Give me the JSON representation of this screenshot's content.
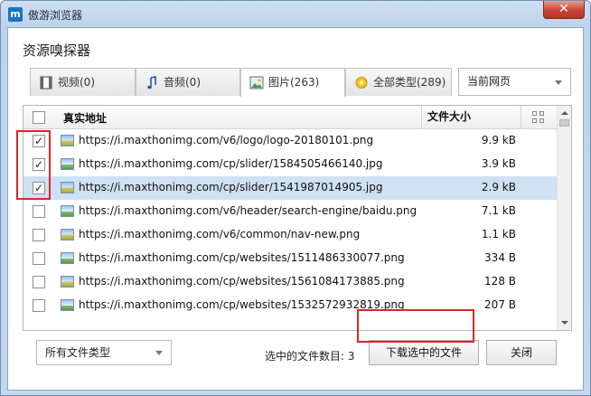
{
  "window": {
    "title": "傲游浏览器",
    "close_glyph": "✕"
  },
  "dialog": {
    "title": "资源嗅探器"
  },
  "tabs": [
    {
      "label": "视频(0)",
      "icon": "film-icon"
    },
    {
      "label": "音频(0)",
      "icon": "music-note-icon"
    },
    {
      "label": "图片(263)",
      "icon": "image-icon",
      "active": true
    },
    {
      "label": "全部类型(289)",
      "icon": "star-icon"
    }
  ],
  "scope_select": {
    "value": "当前网页"
  },
  "list": {
    "header": {
      "url": "真实地址",
      "size": "文件大小"
    },
    "rows": [
      {
        "url": "https://i.maxthonimg.com/v6/logo/logo-20180101.png",
        "size": "9.9 kB",
        "checked": true,
        "selected": false
      },
      {
        "url": "https://i.maxthonimg.com/cp/slider/1584505466140.jpg",
        "size": "3.9 kB",
        "checked": true,
        "selected": false
      },
      {
        "url": "https://i.maxthonimg.com/cp/slider/1541987014905.jpg",
        "size": "2.9 kB",
        "checked": true,
        "selected": true
      },
      {
        "url": "https://i.maxthonimg.com/v6/header/search-engine/baidu.png",
        "size": "7.1 kB",
        "checked": false,
        "selected": false
      },
      {
        "url": "https://i.maxthonimg.com/v6/common/nav-new.png",
        "size": "1.1 kB",
        "checked": false,
        "selected": false
      },
      {
        "url": "https://i.maxthonimg.com/cp/websites/1511486330077.png",
        "size": "334 B",
        "checked": false,
        "selected": false
      },
      {
        "url": "https://i.maxthonimg.com/cp/websites/1561084173885.png",
        "size": "128 B",
        "checked": false,
        "selected": false
      },
      {
        "url": "https://i.maxthonimg.com/cp/websites/1532572932819.png",
        "size": "207 B",
        "checked": false,
        "selected": false
      }
    ]
  },
  "footer": {
    "type_select": "所有文件类型",
    "selected_count_label": "选中的文件数目: 3",
    "download_button": "下载选中的文件",
    "close_button": "关闭"
  },
  "colors": {
    "selection": "#cfe1f3",
    "highlight_box": "#d22a2a",
    "close_button": "#c7483a"
  }
}
